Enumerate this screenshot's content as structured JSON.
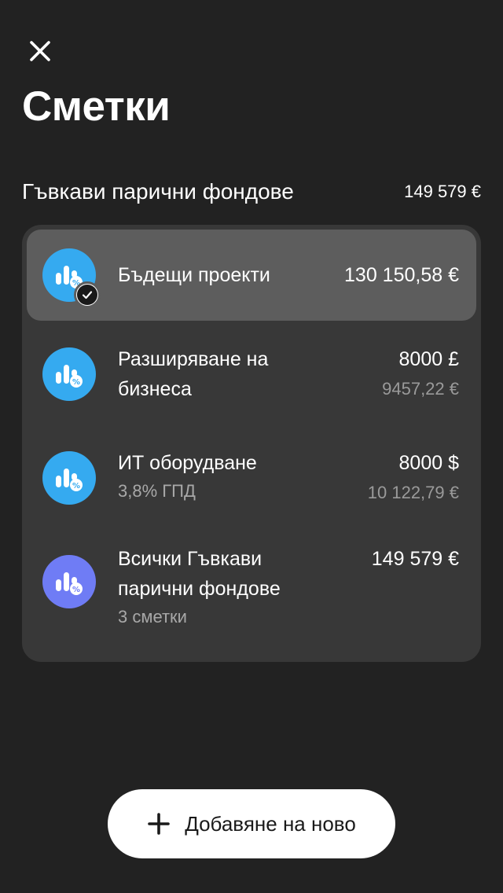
{
  "header": {
    "close_icon": "close-icon",
    "title": "Сметки"
  },
  "section": {
    "title": "Гъвкави парични фондове",
    "total": "149 579 €"
  },
  "accounts": [
    {
      "name": "Бъдещи проекти",
      "subtitle": "",
      "amount": "130 150,58 €",
      "converted": "",
      "selected": true,
      "icon": "savings-chart-percent-icon",
      "icon_color": "#35aaf0"
    },
    {
      "name": "Разширяване на бизнеса",
      "subtitle": "",
      "amount": "8000 £",
      "converted": "9457,22 €",
      "selected": false,
      "icon": "savings-chart-percent-icon",
      "icon_color": "#35aaf0"
    },
    {
      "name": "ИТ оборудване",
      "subtitle": "3,8% ГПД",
      "amount": "8000 $",
      "converted": "10 122,79 €",
      "selected": false,
      "icon": "savings-chart-percent-icon",
      "icon_color": "#35aaf0"
    },
    {
      "name": "Всички Гъвкави парични фондове",
      "subtitle": "3 сметки",
      "amount": "149 579 €",
      "converted": "",
      "selected": false,
      "icon": "savings-chart-percent-icon",
      "icon_color": "#6f7cf5"
    }
  ],
  "footer": {
    "add_icon": "plus-icon",
    "add_label": "Добавяне на ново"
  },
  "colors": {
    "background": "#222222",
    "card": "#383838",
    "selected_row": "#5d5d5d",
    "accent_blue": "#35aaf0",
    "accent_violet": "#6f7cf5"
  }
}
